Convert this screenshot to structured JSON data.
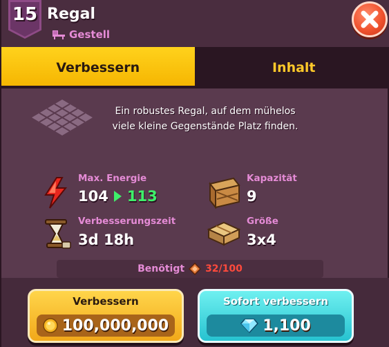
{
  "header": {
    "level": "15",
    "title": "Regal",
    "subtitle": "Gestell",
    "subtitle_icon": "chair-icon",
    "close_icon": "close-icon"
  },
  "tabs": [
    {
      "label": "Verbessern",
      "active": true
    },
    {
      "label": "Inhalt",
      "active": false
    }
  ],
  "description": "Ein robustes Regal, auf dem mühelos viele kleine Gegenstände Platz finden.",
  "stats": {
    "energy": {
      "label": "Max. Energie",
      "current": "104",
      "next": "113",
      "icon": "lightning-icon"
    },
    "capacity": {
      "label": "Kapazität",
      "value": "9",
      "icon": "crate-icon"
    },
    "upgrade_time": {
      "label": "Verbesserungszeit",
      "value": "3d 18h",
      "icon": "hourglass-icon"
    },
    "size": {
      "label": "Größe",
      "value": "3x4",
      "icon": "boxes-icon"
    }
  },
  "required": {
    "label": "Benötigt",
    "count": "32/100",
    "icon": "token-icon"
  },
  "buttons": {
    "upgrade": {
      "label": "Verbessern",
      "value": "100,000,000",
      "icon": "coin-icon"
    },
    "instant": {
      "label": "Sofort verbessern",
      "value": "1,100",
      "icon": "gem-icon"
    }
  },
  "colors": {
    "panel": "#5a3a4e",
    "accent_gold": "#ffc92a",
    "label_pink": "#e58bd6",
    "next_green": "#3ef06a",
    "required_red": "#ff4a3c",
    "instant_cyan": "#27c2d0"
  }
}
